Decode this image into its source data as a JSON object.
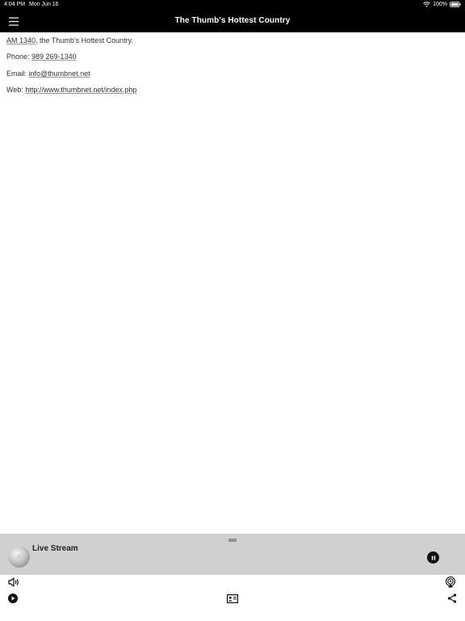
{
  "status_bar": {
    "time": "4:04 PM",
    "date": "Mon Jun 16",
    "battery": "100%"
  },
  "header": {
    "title": "The Thumb's Hottest Country",
    "menu_icon": "hamburger-menu-icon"
  },
  "content": {
    "station_link": "AM 1340",
    "station_tagline": ", the Thumb's Hottest Country.",
    "phone_label": "Phone: ",
    "phone_value": "989 269-1340",
    "email_label": "Email: ",
    "email_value": "info@thumbnet.net",
    "web_label": "Web: ",
    "web_value": "http://www.thumbnet.net/index.php"
  },
  "player": {
    "stream_title": "Live Stream",
    "state": "playing",
    "handle_icon": "drag-handle-icon",
    "pause_icon": "pause-icon"
  },
  "toolbar": {
    "volume_icon": "volume-icon",
    "airplay_icon": "airplay-icon",
    "play_icon": "play-icon",
    "contact_card_icon": "contact-card-icon",
    "share_icon": "share-icon"
  },
  "colors": {
    "nav_background": "#000000",
    "player_background": "#d0d0d0",
    "text": "#333333"
  }
}
